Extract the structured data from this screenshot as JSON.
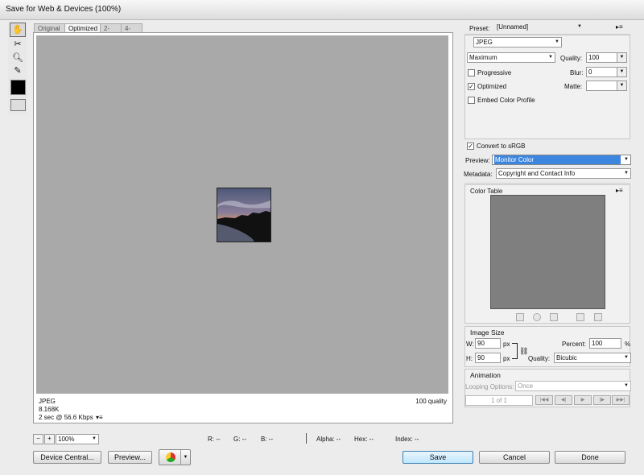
{
  "window": {
    "title": "Save for Web & Devices (100%)"
  },
  "tabs": [
    {
      "label": "Original"
    },
    {
      "label": "Optimized"
    },
    {
      "label": "2-Up"
    },
    {
      "label": "4-Up"
    }
  ],
  "tools": [
    "hand-tool-icon",
    "slice-select-icon",
    "zoom-tool-icon",
    "eyedropper-icon"
  ],
  "preview_info": {
    "format": "JPEG",
    "size": "8.168K",
    "time": "2 sec @ 56.6 Kbps",
    "quality": "100 quality"
  },
  "status": {
    "zoom": "100%",
    "r": "R: --",
    "g": "G: --",
    "b": "B: --",
    "alpha": "Alpha: --",
    "hex": "Hex: --",
    "index": "Index: --"
  },
  "buttons": {
    "device_central": "Device Central...",
    "preview": "Preview...",
    "save": "Save",
    "cancel": "Cancel",
    "done": "Done"
  },
  "settings": {
    "preset_label": "Preset:",
    "preset_value": "[Unnamed]",
    "format": "JPEG",
    "compression": "Maximum",
    "quality_label": "Quality:",
    "quality_value": "100",
    "progressive_label": "Progressive",
    "progressive_checked": false,
    "blur_label": "Blur:",
    "blur_value": "0",
    "optimized_label": "Optimized",
    "optimized_checked": true,
    "matte_label": "Matte:",
    "matte_value": "",
    "embed_label": "Embed Color Profile",
    "embed_checked": false,
    "convert_label": "Convert to sRGB",
    "convert_checked": true,
    "preview_label": "Preview:",
    "preview_value": "Monitor Color",
    "metadata_label": "Metadata:",
    "metadata_value": "Copyright and Contact Info"
  },
  "color_table": {
    "title": "Color Table"
  },
  "image_size": {
    "title": "Image Size",
    "w_label": "W:",
    "w_value": "90",
    "h_label": "H:",
    "h_value": "90",
    "unit": "px",
    "percent_label": "Percent:",
    "percent_value": "100",
    "percent_unit": "%",
    "quality_label": "Quality:",
    "quality_value": "Bicubic"
  },
  "animation": {
    "title": "Animation",
    "looping_label": "Looping Options:",
    "looping_value": "Once",
    "frame": "1 of 1"
  }
}
